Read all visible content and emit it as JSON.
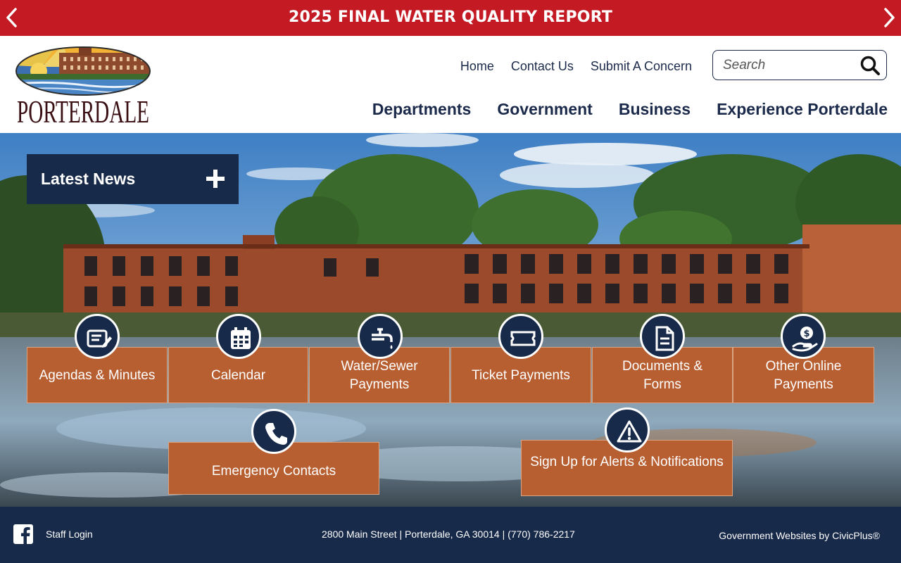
{
  "alert": {
    "title": "2025 FINAL WATER QUALITY REPORT",
    "prev_icon": "chevron-left-icon",
    "next_icon": "chevron-right-icon"
  },
  "header": {
    "logo_text": "PORTERDALE",
    "util_nav": [
      "Home",
      "Contact Us",
      "Submit A Concern"
    ],
    "search": {
      "placeholder": "Search",
      "icon": "search-icon"
    },
    "main_nav": [
      "Departments",
      "Government",
      "Business",
      "Experience Porterdale"
    ]
  },
  "hero": {
    "latest_news": {
      "label": "Latest News",
      "icon": "plus-icon"
    },
    "quick_links_row1": [
      {
        "label": "Agendas & Minutes",
        "icon": "agenda-icon"
      },
      {
        "label": "Calendar",
        "icon": "calendar-icon"
      },
      {
        "label": "Water/Sewer Payments",
        "icon": "water-faucet-icon"
      },
      {
        "label": "Ticket Payments",
        "icon": "ticket-icon"
      },
      {
        "label": "Documents & Forms",
        "icon": "document-icon"
      },
      {
        "label": "Other Online Payments",
        "icon": "payment-hand-icon"
      }
    ],
    "quick_links_row2": [
      {
        "label": "Emergency Contacts",
        "icon": "phone-icon"
      },
      {
        "label": "Sign Up for Alerts & Notifications",
        "icon": "alert-triangle-icon"
      }
    ]
  },
  "footer": {
    "facebook_icon": "facebook-icon",
    "staff_login": "Staff Login",
    "address": "2800 Main Street | Porterdale, GA 30014 | (770) 786-2217",
    "credit": "Government Websites by CivicPlus®"
  },
  "colors": {
    "alert_red": "#c41a24",
    "navy": "#182a4a",
    "quick_link_orange": "#b85f32"
  }
}
